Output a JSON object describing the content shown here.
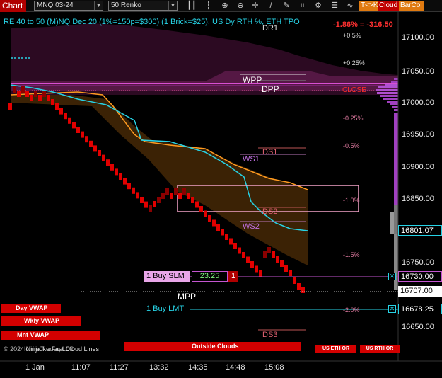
{
  "toolbar": {
    "title": "Chart",
    "instrument": "MNQ 03-24",
    "bar_type": "50 Renko",
    "btn_tk": "T<>K",
    "btn_cloud": "Cloud",
    "btn_barcol": "BarCol",
    "icons": [
      "bar-chart-icon",
      "line-chart-icon",
      "zoom-in-icon",
      "zoom-out-icon",
      "crosshair-icon",
      "line-tool-icon",
      "pencil-icon",
      "measure-icon",
      "properties-icon",
      "more-icon",
      "indicator-icon"
    ]
  },
  "header": {
    "study_line": "RE 40 to 50 (M)NQ Dec 20 (1%=150p=$300) (1 Brick=$25), US Dy RTH %, ETH TPO",
    "change": "-1.86% = -316.50"
  },
  "levels": {
    "dr1": "DR1",
    "wpp": "WPP",
    "dpp": "DPP",
    "close": "CLOSE",
    "ds1": "DS1",
    "ws1": "WS1",
    "ds2": "DS2",
    "ws2": "WS2",
    "mpp": "MPP",
    "ds3": "DS3"
  },
  "pct_labels": [
    "+0.5%",
    "+0.25%",
    "-0.25%",
    "-0.5%",
    "-1.0%",
    "-1.5%",
    "-2.0%"
  ],
  "price_axis": {
    "ticks": [
      "17100.00",
      "17050.00",
      "17000.00",
      "16950.00",
      "16900.00",
      "16850.00",
      "16750.00",
      "16650.00"
    ],
    "tag_current": "16801.07",
    "tag_buy_slm": "16730.00",
    "tag_last": "16707.00",
    "tag_buy_lmt": "16678.25"
  },
  "time_axis": [
    "1 Jan",
    "11:07",
    "11:27",
    "13:32",
    "14:35",
    "14:48",
    "15:08"
  ],
  "orders": {
    "buy_slm_label": "1 Buy SLM",
    "buy_slm_price": "23.25",
    "buy_slm_qty": "1",
    "buy_lmt_label": "1 Buy LMT"
  },
  "buttons": {
    "day_vwap": "Day VWAP",
    "wkly_vwap": "Wkly VWAP",
    "mnt_vwap": "Mnt VWAP",
    "outside_clouds": "Outside Clouds",
    "us_eth_or": "US ETH OR",
    "us_rth_or": "US RTH OR"
  },
  "footer": {
    "copyright": "© 2024 NinjaTrader, LLC",
    "ichimoku": "Ichimoku Fast Cloud Lines"
  },
  "colors": {
    "brick_down": "#e10000",
    "brick_up": "#8a0000",
    "cyan": "#27d3e6",
    "orange": "#ff9a1f",
    "magenta": "#c455d0",
    "cloud": "#4b2a05",
    "pink_box": "#f2a2c8"
  }
}
